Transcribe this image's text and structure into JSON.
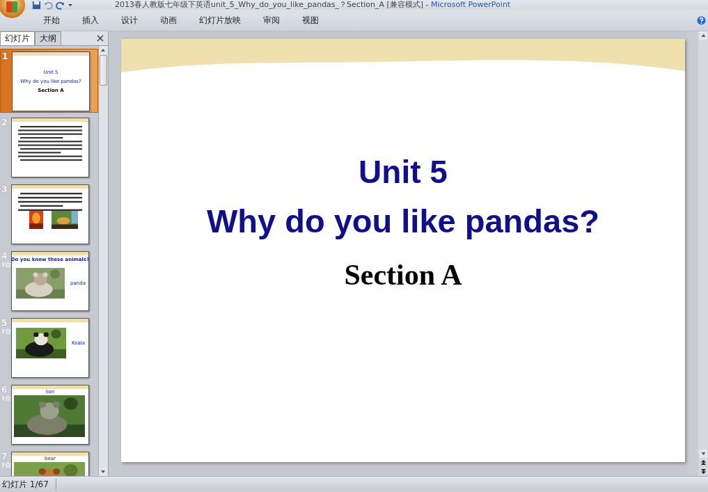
{
  "window": {
    "title": "2013春人教版七年级下英语unit_5_Why_do_you_like_pandas_？Section_A [兼容模式]",
    "app": "- Microsoft PowerPoint"
  },
  "ribbon_tabs": [
    {
      "label": "开始",
      "selected": false
    },
    {
      "label": "插入",
      "selected": false
    },
    {
      "label": "设计",
      "selected": false
    },
    {
      "label": "动画",
      "selected": false
    },
    {
      "label": "幻灯片放映",
      "selected": false
    },
    {
      "label": "审阅",
      "selected": false
    },
    {
      "label": "视图",
      "selected": false
    }
  ],
  "panel_tabs": [
    {
      "label": "幻灯片",
      "selected": true
    },
    {
      "label": "大纲",
      "selected": false
    }
  ],
  "slides": [
    {
      "number": "1",
      "selected": true,
      "animated": false,
      "kind": "title",
      "texts": [
        "Unit 5",
        "Why do you like pandas?",
        "Section A"
      ]
    },
    {
      "number": "2",
      "selected": false,
      "animated": false,
      "kind": "text"
    },
    {
      "number": "3",
      "selected": false,
      "animated": false,
      "kind": "text_pictures"
    },
    {
      "number": "4",
      "selected": false,
      "animated": true,
      "kind": "caption_picture",
      "heading": "Do you know these animals?",
      "caption": "panda"
    },
    {
      "number": "5",
      "selected": false,
      "animated": true,
      "kind": "caption_picture",
      "caption": "Koala"
    },
    {
      "number": "6",
      "selected": false,
      "animated": true,
      "kind": "titled_picture",
      "heading": "lion"
    },
    {
      "number": "7",
      "selected": false,
      "animated": true,
      "kind": "titled_picture",
      "heading": "bear"
    }
  ],
  "slide": {
    "unit": "Unit 5",
    "title": "Why do you like pandas?",
    "section": "Section A"
  },
  "status_bar": {
    "slide_counter": "幻灯片 1/67"
  }
}
